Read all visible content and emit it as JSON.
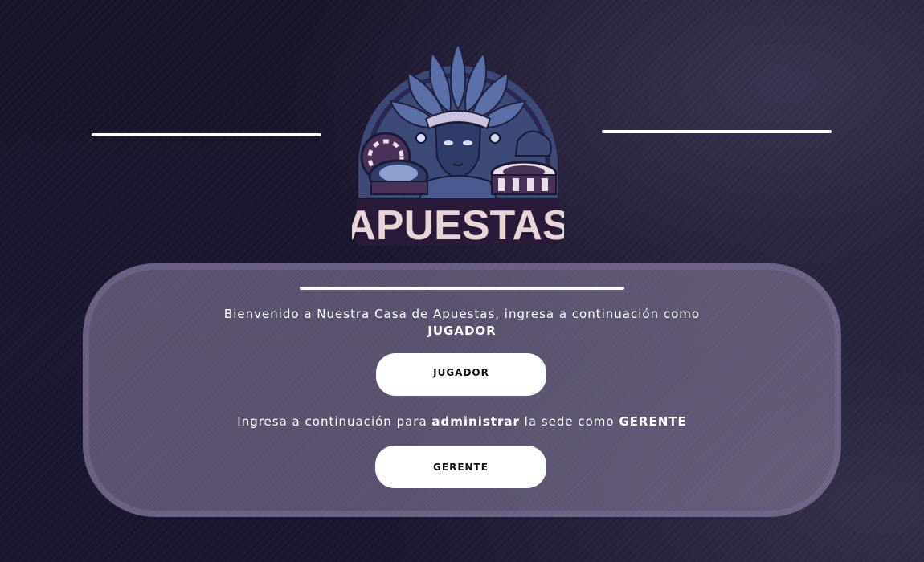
{
  "logo": {
    "text": "APUESTAS",
    "icon": "aztec-casino-logo-icon"
  },
  "welcome": {
    "line1": "Bienvenido a Nuestra Casa de Apuestas, ingresa a continuación como",
    "line2": "JUGADOR"
  },
  "buttons": {
    "jugador": "JUGADOR",
    "gerente": "GERENTE"
  },
  "admin": {
    "part1": "Ingresa a continuación para ",
    "bold1": "administrar",
    "part2": " la sede como ",
    "bold2": "GERENTE"
  },
  "colors": {
    "background": "#1b1730",
    "panel": "#8c82a0",
    "button": "#ffffff",
    "logo_blue": "#5b6fa8",
    "logo_purple": "#4a3158",
    "logo_text": "#e9d4d8"
  }
}
